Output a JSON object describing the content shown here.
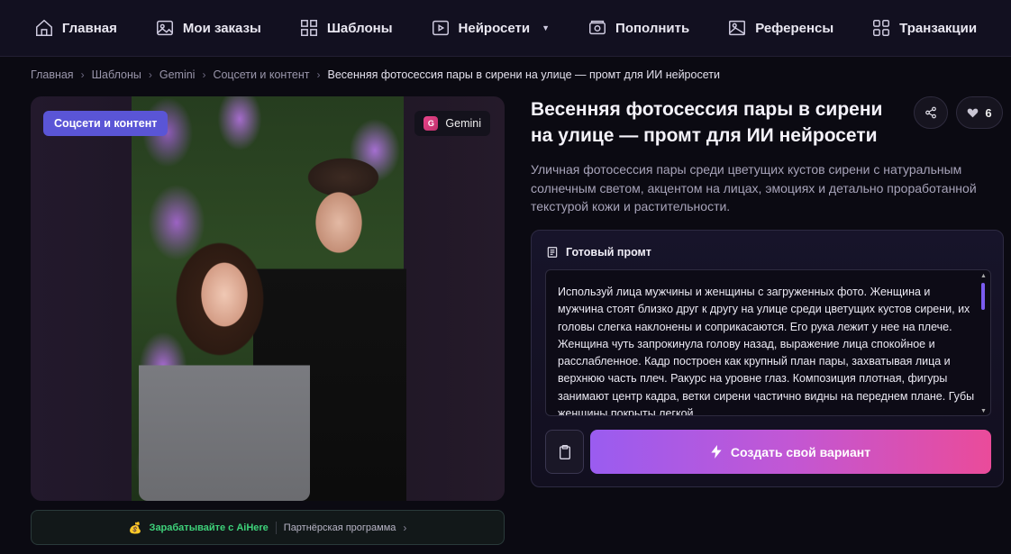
{
  "nav": {
    "items": [
      {
        "label": "Главная",
        "icon": "home-icon"
      },
      {
        "label": "Мои заказы",
        "icon": "image-icon"
      },
      {
        "label": "Шаблоны",
        "icon": "grid-icon"
      },
      {
        "label": "Нейросети",
        "icon": "play-icon",
        "has_dropdown": true
      },
      {
        "label": "Пополнить",
        "icon": "wallet-icon"
      },
      {
        "label": "Референсы",
        "icon": "picture-icon"
      },
      {
        "label": "Транзакции",
        "icon": "squares-icon"
      }
    ]
  },
  "breadcrumb": {
    "items": [
      "Главная",
      "Шаблоны",
      "Gemini",
      "Соцсети и контент"
    ],
    "current": "Весенняя фотосессия пары в сирени на улице — промт для ИИ нейросети"
  },
  "image_card": {
    "category_badge": "Соцсети и контент",
    "model_badge": "Gemini",
    "model_logo_letter": "G"
  },
  "affiliate": {
    "earn_text": "Зарабатывайте с AiHere",
    "partner_text": "Партнёрская программа"
  },
  "product": {
    "title": "Весенняя фотосессия пары в сирени на улице — промт для ИИ нейросети",
    "likes": "6",
    "description": "Уличная фотосессия пары среди цветущих кустов сирени с натуральным солнечным светом, акцентом на лицах, эмоциях и детально проработанной текстурой кожи и растительности."
  },
  "prompt": {
    "heading": "Готовый промт",
    "text": "Используй лица мужчины и женщины с загруженных фото. Женщина и мужчина стоят близко друг к другу на улице среди цветущих кустов сирени, их головы слегка наклонены и соприкасаются. Его рука лежит у нее на плече. Женщина чуть запрокинула голову назад, выражение лица спокойное и расслабленное. Кадр построен как крупный план пары, захватывая лица и верхнюю часть плеч. Ракурс на уровне глаз. Композиция плотная, фигуры занимают центр кадра, ветки сирени частично видны на переднем плане. Губы женщины покрыты легкой",
    "create_button": "Создать свой вариант"
  },
  "colors": {
    "accent_purple": "#5a55d6",
    "gradient_start": "#9a5cf0",
    "gradient_end": "#ea4b9a",
    "earn_green": "#3ed27a"
  }
}
